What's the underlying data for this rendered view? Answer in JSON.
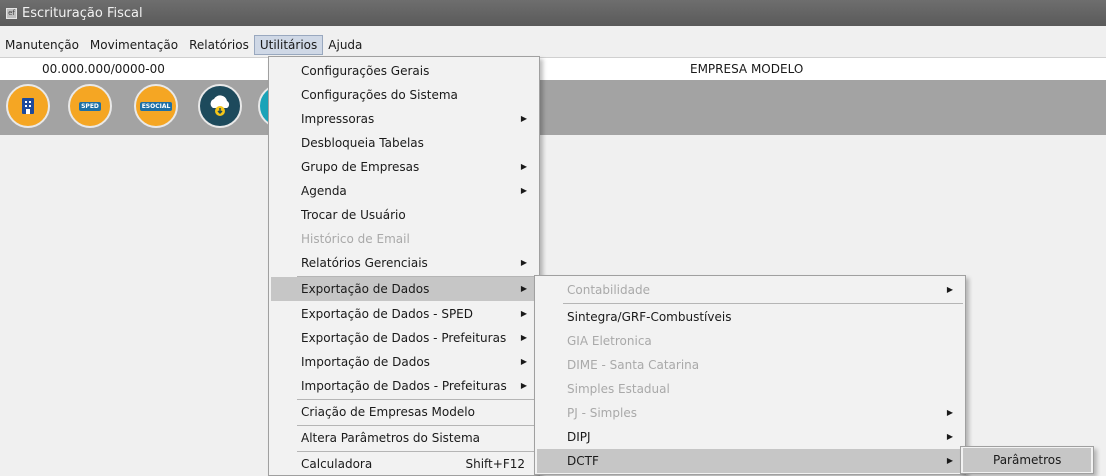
{
  "window": {
    "title": "Escrituração Fiscal"
  },
  "menubar": [
    "Manutenção",
    "Movimentação",
    "Relatórios",
    "Utilitários",
    "Ajuda"
  ],
  "info": {
    "cnpj": "00.000.000/0000-00",
    "empresa": "EMPRESA MODELO"
  },
  "toolbar": {
    "buttons": [
      {
        "name": "empresa-icon",
        "color": "#f5a623"
      },
      {
        "name": "sped-icon",
        "label": "SPED",
        "color": "#f5a623"
      },
      {
        "name": "esocial-icon",
        "label": "ESOCIAL",
        "color": "#f5a623"
      },
      {
        "name": "cloud-download-icon",
        "color": "#1d4a5c"
      },
      {
        "name": "partial-icon",
        "color": "#1aa3b8"
      }
    ]
  },
  "menu_utilitarios": {
    "items": [
      {
        "label": "Configurações Gerais"
      },
      {
        "label": "Configurações do Sistema"
      },
      {
        "label": "Impressoras",
        "submenu": true
      },
      {
        "label": "Desbloqueia Tabelas"
      },
      {
        "label": "Grupo de Empresas",
        "submenu": true
      },
      {
        "label": "Agenda",
        "submenu": true
      },
      {
        "label": "Trocar de Usuário"
      },
      {
        "label": "Histórico de Email",
        "disabled": true
      },
      {
        "label": "Relatórios Gerenciais",
        "submenu": true
      },
      {
        "label": "Exportação de Dados",
        "submenu": true,
        "highlighted": true
      },
      {
        "label": "Exportação de Dados - SPED",
        "submenu": true
      },
      {
        "label": "Exportação de Dados - Prefeituras",
        "submenu": true
      },
      {
        "label": "Importação de Dados",
        "submenu": true
      },
      {
        "label": "Importação de Dados - Prefeituras",
        "submenu": true
      },
      {
        "label": "Criação de Empresas Modelo"
      },
      {
        "label": "Altera Parâmetros do Sistema"
      },
      {
        "label": "Calculadora",
        "shortcut": "Shift+F12"
      }
    ]
  },
  "menu_exportacao": {
    "items": [
      {
        "label": "Contabilidade",
        "submenu": true,
        "disabled": true
      },
      {
        "label": "Sintegra/GRF-Combustíveis"
      },
      {
        "label": "GIA Eletronica",
        "disabled": true
      },
      {
        "label": "DIME - Santa Catarina",
        "disabled": true
      },
      {
        "label": "Simples Estadual",
        "disabled": true
      },
      {
        "label": "PJ - Simples",
        "submenu": true,
        "disabled": true
      },
      {
        "label": "DIPJ",
        "submenu": true
      },
      {
        "label": "DCTF",
        "submenu": true,
        "highlighted": true
      }
    ]
  },
  "menu_dctf": {
    "items": [
      {
        "label": "Parâmetros",
        "highlighted": true
      }
    ]
  }
}
